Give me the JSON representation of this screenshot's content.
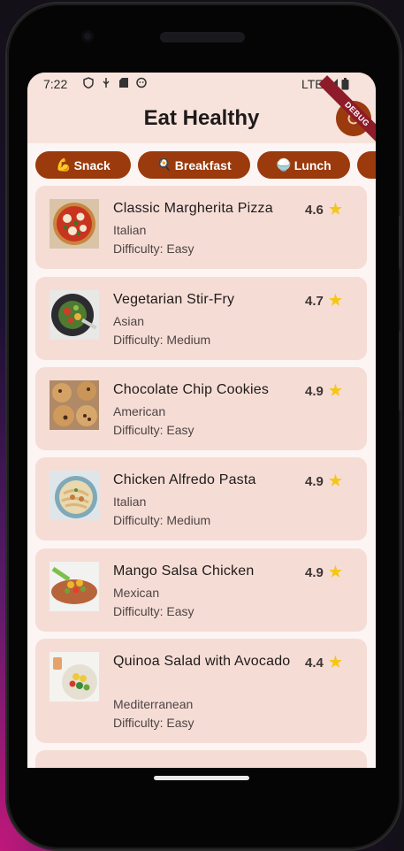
{
  "status": {
    "time": "7:22",
    "network": "LTE"
  },
  "app": {
    "title": "Eat Healthy",
    "debug_banner": "DEBUG"
  },
  "filters": [
    {
      "emoji": "💪",
      "label": "Snack"
    },
    {
      "emoji": "🍳",
      "label": "Breakfast"
    },
    {
      "emoji": "🍚",
      "label": "Lunch"
    }
  ],
  "recipes": [
    {
      "name": "Classic Margherita Pizza",
      "cuisine": "Italian",
      "difficulty": "Difficulty: Easy",
      "rating": "4.6"
    },
    {
      "name": "Vegetarian Stir-Fry",
      "cuisine": "Asian",
      "difficulty": "Difficulty: Medium",
      "rating": "4.7"
    },
    {
      "name": "Chocolate Chip Cookies",
      "cuisine": "American",
      "difficulty": "Difficulty: Easy",
      "rating": "4.9"
    },
    {
      "name": "Chicken Alfredo Pasta",
      "cuisine": "Italian",
      "difficulty": "Difficulty: Medium",
      "rating": "4.9"
    },
    {
      "name": "Mango Salsa Chicken",
      "cuisine": "Mexican",
      "difficulty": "Difficulty: Easy",
      "rating": "4.9"
    },
    {
      "name": "Quinoa Salad with Avocado",
      "cuisine": "Mediterranean",
      "difficulty": "Difficulty: Easy",
      "rating": "4.4"
    }
  ],
  "icons": {
    "star": "star-icon",
    "refresh": "refresh-icon"
  },
  "colors": {
    "primary": "#9b3a0c",
    "card": "#f5ddd6",
    "appbar": "#f7e3dc"
  }
}
